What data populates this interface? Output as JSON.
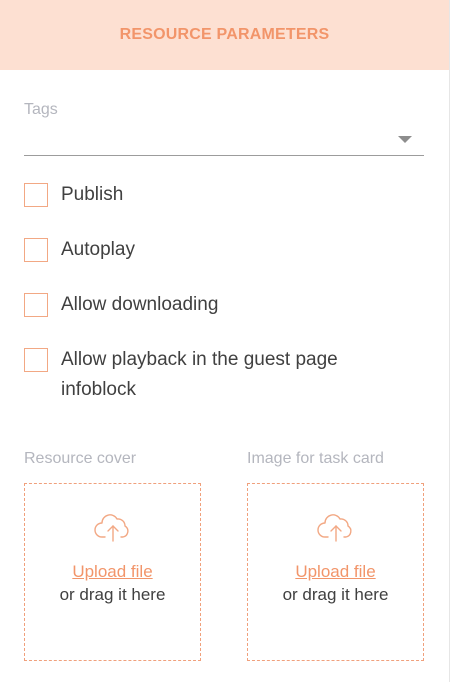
{
  "header": {
    "title": "RESOURCE PARAMETERS"
  },
  "tags": {
    "label": "Tags",
    "value": ""
  },
  "checkboxes": [
    {
      "label": "Publish",
      "checked": false
    },
    {
      "label": "Autoplay",
      "checked": false
    },
    {
      "label": "Allow downloading",
      "checked": false
    },
    {
      "label": "Allow playback in the guest page infoblock",
      "checked": false
    }
  ],
  "uploads": [
    {
      "label": "Resource cover",
      "link": "Upload file",
      "hint": "or drag it here"
    },
    {
      "label": "Image for task card",
      "link": "Upload file",
      "hint": "or drag it here"
    }
  ],
  "colors": {
    "accent": "#f2956a",
    "header_bg": "#fde0d2",
    "muted": "#b4b6be"
  },
  "icons": {
    "upload": "cloud-upload-icon",
    "dropdown": "chevron-down-icon"
  }
}
